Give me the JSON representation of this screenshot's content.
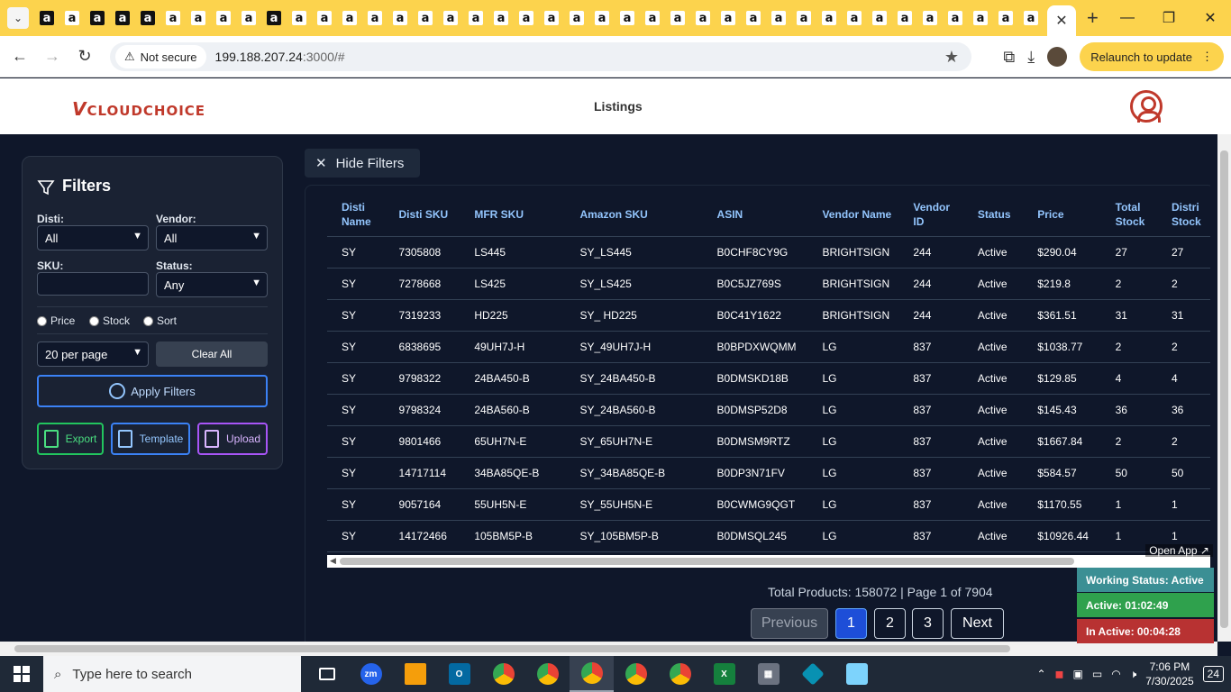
{
  "browser": {
    "favicons": [
      "a",
      "a",
      "a",
      "a",
      "a",
      "a",
      "a",
      "a",
      "a",
      "a",
      "a",
      "a",
      "a",
      "a",
      "a",
      "a",
      "a",
      "a",
      "a",
      "a",
      "a",
      "a",
      "a",
      "a",
      "a",
      "a",
      "a",
      "a",
      "a",
      "a",
      "a",
      "a",
      "a",
      "a",
      "a",
      "a",
      "a",
      "a",
      "a",
      "a"
    ],
    "active_tab_close": "✕",
    "new_tab": "+",
    "security_label": "Not secure",
    "url_host": "199.188.207.24",
    "url_rest": ":3000/#",
    "relaunch_label": "Relaunch to update",
    "minimize": "—",
    "maximize": "❐",
    "close": "✕"
  },
  "header": {
    "logo_v": "V",
    "logo_text": "CLOUDCHOICE",
    "title": "Listings"
  },
  "filters": {
    "title": "Filters",
    "disti_label": "Disti:",
    "disti_value": "All",
    "vendor_label": "Vendor:",
    "vendor_value": "All",
    "sku_label": "SKU:",
    "status_label": "Status:",
    "status_value": "Any",
    "radio_price": "Price",
    "radio_stock": "Stock",
    "radio_sort": "Sort",
    "per_page": "20 per page",
    "clear_all": "Clear All",
    "apply": "Apply Filters",
    "export": "Export",
    "template": "Template",
    "upload": "Upload"
  },
  "hide_filters": "Hide Filters",
  "table": {
    "headers": [
      "Disti Name",
      "Disti SKU",
      "MFR SKU",
      "Amazon SKU",
      "ASIN",
      "Vendor Name",
      "Vendor ID",
      "Status",
      "Price",
      "Total Stock",
      "Distri Stock"
    ],
    "rows": [
      [
        "SY",
        "7305808",
        "LS445",
        "SY_LS445",
        "B0CHF8CY9G",
        "BRIGHTSIGN",
        "244",
        "Active",
        "$290.04",
        "27",
        "27"
      ],
      [
        "SY",
        "7278668",
        "LS425",
        "SY_LS425",
        "B0C5JZ769S",
        "BRIGHTSIGN",
        "244",
        "Active",
        "$219.8",
        "2",
        "2"
      ],
      [
        "SY",
        "7319233",
        "HD225",
        "SY_ HD225",
        "B0C41Y1622",
        "BRIGHTSIGN",
        "244",
        "Active",
        "$361.51",
        "31",
        "31"
      ],
      [
        "SY",
        "6838695",
        "49UH7J-H",
        "SY_49UH7J-H",
        "B0BPDXWQMM",
        "LG",
        "837",
        "Active",
        "$1038.77",
        "2",
        "2"
      ],
      [
        "SY",
        "9798322",
        "24BA450-B",
        "SY_24BA450-B",
        "B0DMSKD18B",
        "LG",
        "837",
        "Active",
        "$129.85",
        "4",
        "4"
      ],
      [
        "SY",
        "9798324",
        "24BA560-B",
        "SY_24BA560-B",
        "B0DMSP52D8",
        "LG",
        "837",
        "Active",
        "$145.43",
        "36",
        "36"
      ],
      [
        "SY",
        "9801466",
        "65UH7N-E",
        "SY_65UH7N-E",
        "B0DMSM9RTZ",
        "LG",
        "837",
        "Active",
        "$1667.84",
        "2",
        "2"
      ],
      [
        "SY",
        "14717114",
        "34BA85QE-B",
        "SY_34BA85QE-B",
        "B0DP3N71FV",
        "LG",
        "837",
        "Active",
        "$584.57",
        "50",
        "50"
      ],
      [
        "SY",
        "9057164",
        "55UH5N-E",
        "SY_55UH5N-E",
        "B0CWMG9QGT",
        "LG",
        "837",
        "Active",
        "$1170.55",
        "1",
        "1"
      ],
      [
        "SY",
        "14172466",
        "105BM5P-B",
        "SY_105BM5P-B",
        "B0DMSQL245",
        "LG",
        "837",
        "Active",
        "$10926.44",
        "1",
        "1"
      ]
    ]
  },
  "summary": "Total Products: 158072 | Page 1 of 7904",
  "pagination": {
    "previous": "Previous",
    "pages": [
      "1",
      "2",
      "3"
    ],
    "next": "Next"
  },
  "widget": {
    "open_app": "Open App ↗",
    "working": "Working Status: Active",
    "active": "Active: 01:02:49",
    "inactive": "In Active: 00:04:28"
  },
  "taskbar": {
    "search_placeholder": "Type here to search",
    "time": "7:06 PM",
    "date": "7/30/2025",
    "notifications": "24"
  },
  "colors": {
    "tab_bar": "#fcd34d",
    "app_bg": "#0f172a",
    "header_text": "#93c5fd",
    "accent_blue": "#1d4ed8",
    "export_green": "#22c55e",
    "template_blue": "#3b82f6",
    "upload_purple": "#a855f7",
    "working_teal": "#3b8f94",
    "active_green": "#2fa14d",
    "inactive_red": "#b83232"
  }
}
